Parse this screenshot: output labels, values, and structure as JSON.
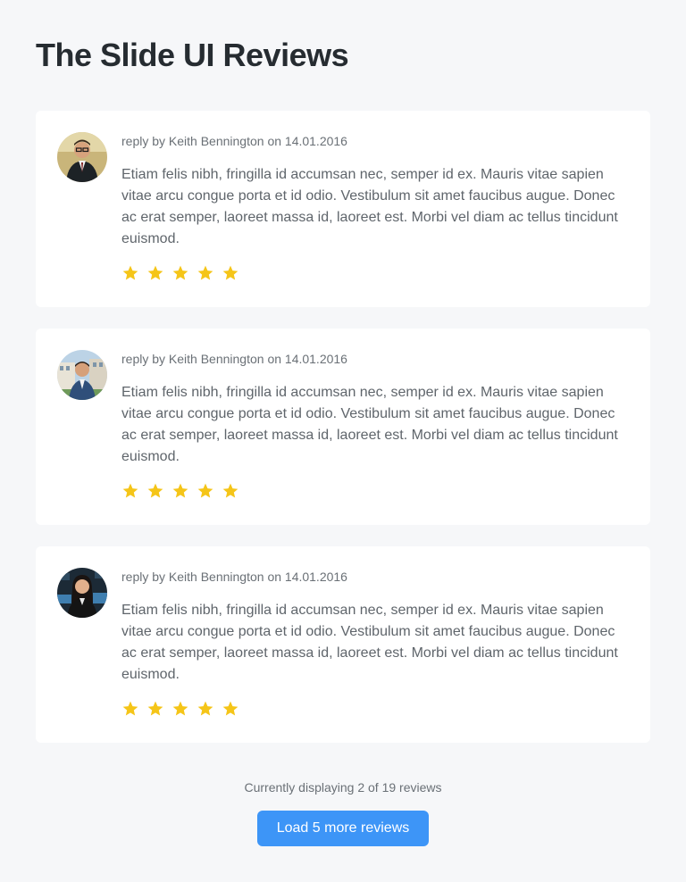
{
  "page": {
    "title": "The Slide UI Reviews"
  },
  "reviews": [
    {
      "meta": "reply by Keith Bennington on 14.01.2016",
      "text": "Etiam felis nibh, fringilla id accumsan nec, semper id ex. Mauris vitae sapien vitae arcu congue porta et id odio. Vestibulum sit amet faucibus augue. Donec ac erat semper, laoreet massa id, laoreet est. Morbi vel diam ac tellus tincidunt euismod.",
      "rating": 5,
      "avatar": "avatar-man-suit-glasses"
    },
    {
      "meta": "reply by Keith Bennington on 14.01.2016",
      "text": "Etiam felis nibh, fringilla id accumsan nec, semper id ex. Mauris vitae sapien vitae arcu congue porta et id odio. Vestibulum sit amet faucibus augue. Donec ac erat semper, laoreet massa id, laoreet est. Morbi vel diam ac tellus tincidunt euismod.",
      "rating": 5,
      "avatar": "avatar-man-building"
    },
    {
      "meta": "reply by Keith Bennington on 14.01.2016",
      "text": "Etiam felis nibh, fringilla id accumsan nec, semper id ex. Mauris vitae sapien vitae arcu congue porta et id odio. Vestibulum sit amet faucibus augue. Donec ac erat semper, laoreet massa id, laoreet est. Morbi vel diam ac tellus tincidunt euismod.",
      "rating": 5,
      "avatar": "avatar-woman-office"
    }
  ],
  "footer": {
    "count_text": "Currently displaying 2 of 19 reviews",
    "load_button": "Load 5 more reviews"
  },
  "colors": {
    "background": "#f6f7f9",
    "card": "#ffffff",
    "star": "#f5c518",
    "button": "#3d95f7"
  }
}
